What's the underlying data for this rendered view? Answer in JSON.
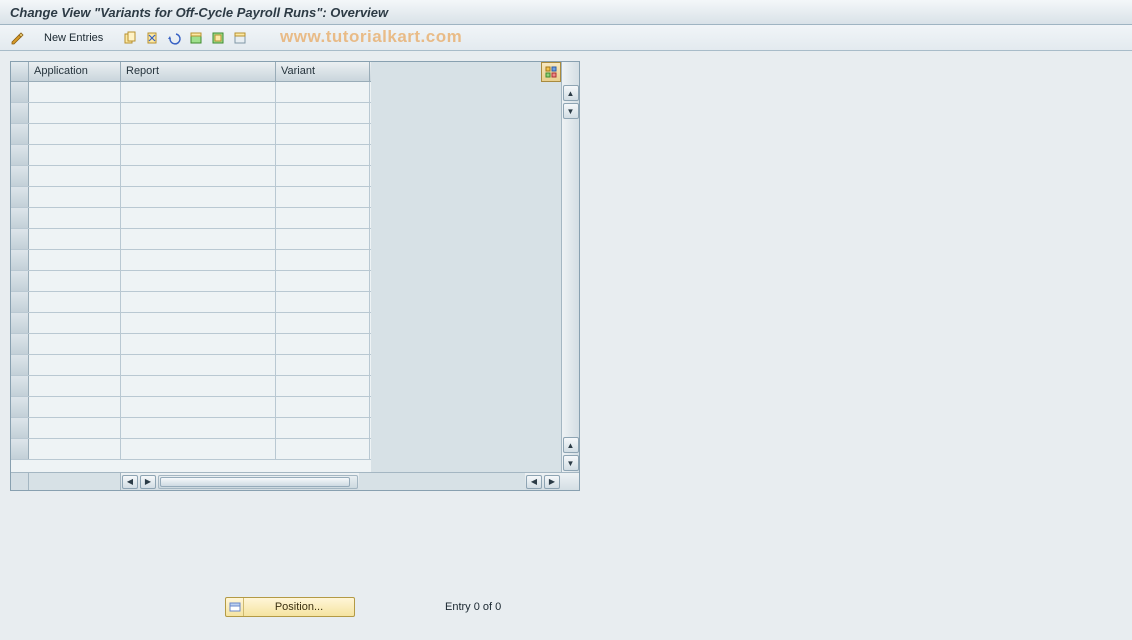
{
  "title": "Change View \"Variants for Off-Cycle Payroll Runs\": Overview",
  "toolbar": {
    "new_entries_label": "New Entries"
  },
  "watermark": "www.tutorialkart.com",
  "table": {
    "columns": [
      "Application",
      "Report",
      "Variant"
    ],
    "rows": [
      {
        "application": "",
        "report": "",
        "variant": ""
      },
      {
        "application": "",
        "report": "",
        "variant": ""
      },
      {
        "application": "",
        "report": "",
        "variant": ""
      },
      {
        "application": "",
        "report": "",
        "variant": ""
      },
      {
        "application": "",
        "report": "",
        "variant": ""
      },
      {
        "application": "",
        "report": "",
        "variant": ""
      },
      {
        "application": "",
        "report": "",
        "variant": ""
      },
      {
        "application": "",
        "report": "",
        "variant": ""
      },
      {
        "application": "",
        "report": "",
        "variant": ""
      },
      {
        "application": "",
        "report": "",
        "variant": ""
      },
      {
        "application": "",
        "report": "",
        "variant": ""
      },
      {
        "application": "",
        "report": "",
        "variant": ""
      },
      {
        "application": "",
        "report": "",
        "variant": ""
      },
      {
        "application": "",
        "report": "",
        "variant": ""
      },
      {
        "application": "",
        "report": "",
        "variant": ""
      },
      {
        "application": "",
        "report": "",
        "variant": ""
      },
      {
        "application": "",
        "report": "",
        "variant": ""
      },
      {
        "application": "",
        "report": "",
        "variant": ""
      }
    ]
  },
  "footer": {
    "position_label": "Position...",
    "entry_text": "Entry 0 of 0"
  }
}
